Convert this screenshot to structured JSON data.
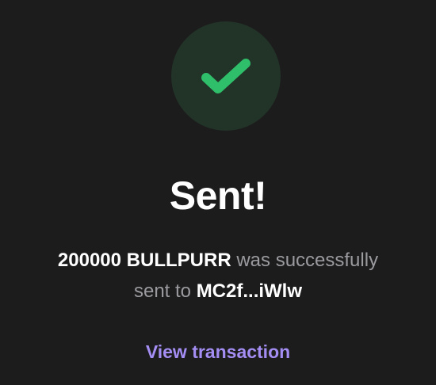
{
  "status": {
    "icon": "checkmark-icon",
    "title": "Sent!"
  },
  "message": {
    "amount": "200000",
    "token": "BULLPURR",
    "middle_text": "was successfully",
    "sent_to_text": "sent to",
    "recipient": "MC2f...iWlw"
  },
  "actions": {
    "view_transaction_label": "View transaction"
  },
  "colors": {
    "background": "#1c1c1d",
    "success_green": "#2fbf6a",
    "success_circle": "#223328",
    "link_purple": "#a48ef4",
    "muted_text": "#9b9b9f"
  }
}
